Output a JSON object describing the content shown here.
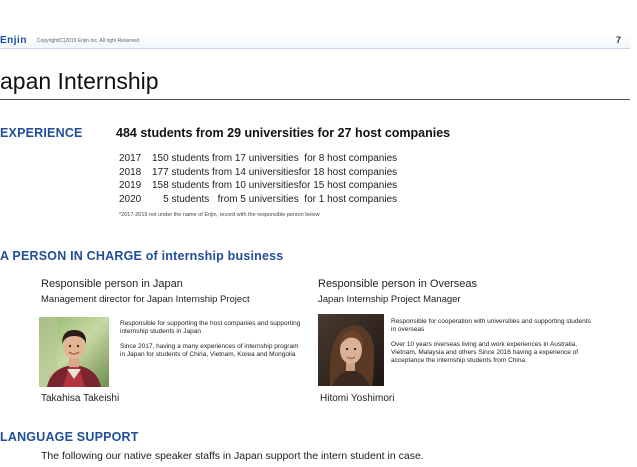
{
  "header": {
    "logo": "Enjin",
    "copyright": "Copyright(C)2019 Enjin Inc. All right Reserved",
    "page_number": "7"
  },
  "page_title": "apan Internship",
  "experience": {
    "heading": "EXPERIENCE",
    "summary": "484  students from 29 universities for 27 host companies",
    "rows": [
      {
        "year": "2017",
        "text": "150 students from 17 universities  for 8 host companies"
      },
      {
        "year": "2018",
        "text": "177 students from 14 universitiesfor 18 host companies"
      },
      {
        "year": "2019",
        "text": "158 students from 10 universitiesfor 15 host companies"
      },
      {
        "year": "2020",
        "text": "    5 students   from 5 universities  for 1 host companies"
      }
    ],
    "note": "*2017-2019  not under the name of Enjin, record with the responsible person below"
  },
  "person_in_charge": {
    "heading": "A PERSON IN CHARGE of internship business",
    "japan": {
      "role": "Responsible person in Japan",
      "subrole": "Management director for Japan Internship Project",
      "desc_1": "Responsible for supporting the host companies and supporting internship students in Japan",
      "desc_2": "Since 2017, having a many experiences of internship program in Japan for students of China, Vietnam, Korea and Mongolia",
      "name": "Takahisa Takeishi"
    },
    "overseas": {
      "role": "Responsible person in Overseas",
      "subrole": "Japan Internship Project Manager",
      "desc_1": "Responsible for cooperation with universities and supporting students in overseas",
      "desc_2": "Over 10  years overseas living and work experiences in Australia, Vietnam, Malaysia and others Since 2016 having a experience of acceptance the internship students from China.",
      "name": "Hitomi Yoshimori"
    }
  },
  "language_support": {
    "heading": "LANGUAGE SUPPORT",
    "text": "The following our native speaker staffs in Japan support the intern student in case."
  },
  "colors": {
    "accent": "#1f4e9a",
    "text": "#222222"
  }
}
